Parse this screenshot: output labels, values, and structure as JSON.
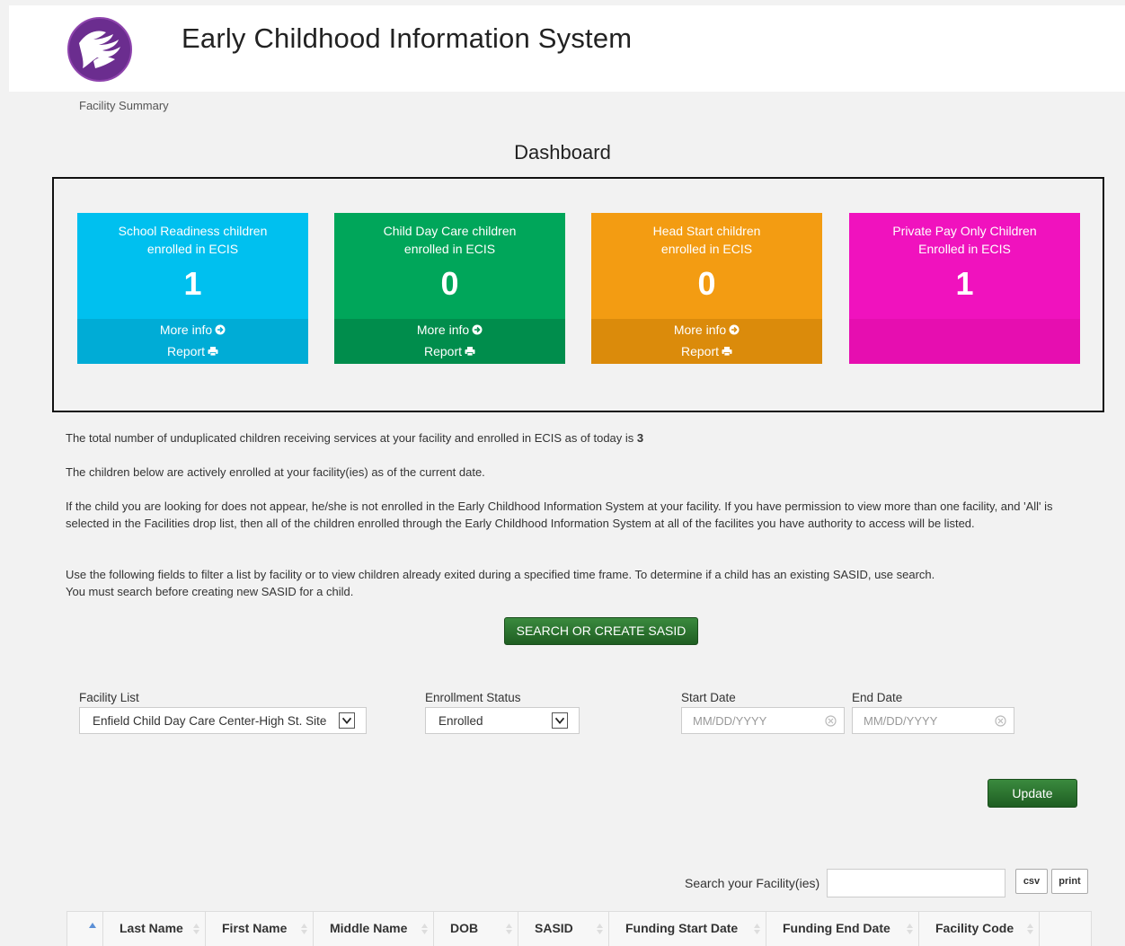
{
  "app": {
    "title": "Early Childhood Information System"
  },
  "breadcrumb": "Facility Summary",
  "dashboard": {
    "title": "Dashboard",
    "tiles": [
      {
        "line1": "School Readiness children",
        "line2": "enrolled in ECIS",
        "count": "1",
        "more_info": "More info",
        "report": "Report",
        "color": "#00c0ef",
        "footer_color": "#00acd6"
      },
      {
        "line1": "Child Day Care children",
        "line2": "enrolled in ECIS",
        "count": "0",
        "more_info": "More info",
        "report": "Report",
        "color": "#00a65a",
        "footer_color": "#008d4c"
      },
      {
        "line1": "Head Start children",
        "line2": "enrolled in ECIS",
        "count": "0",
        "more_info": "More info",
        "report": "Report",
        "color": "#f39c12",
        "footer_color": "#db8b0b"
      },
      {
        "line1": "Private Pay Only Children",
        "line2": "Enrolled in ECIS",
        "count": "1",
        "color": "#f012be",
        "footer_color": "#e60eb0"
      }
    ]
  },
  "info": {
    "total_text": "The total number of unduplicated children receiving services at your facility and enrolled in ECIS as of today is",
    "total_count": "3",
    "active_text": "The children below are actively enrolled at your facility(ies) as of the current date.",
    "not_found_text": "If the child you are looking for does not appear, he/she is not enrolled in the Early Childhood Information System at your facility. If you have permission to view more than one facility, and 'All' is selected in the Facilities drop list, then all of the children enrolled through the Early Childhood Information System at all of the facilites you have authority to access will be listed.",
    "filter_text_1": "Use the following fields to filter a list by facility or to view children already exited during a specified time frame. To determine if a child has an existing SASID, use search.",
    "filter_text_2": "You must search before creating new SASID for a child."
  },
  "search_sasid_button": "SEARCH OR CREATE SASID",
  "filters": {
    "facility_label": "Facility List",
    "facility_value": "Enfield Child Day Care Center-High St. Site",
    "status_label": "Enrollment Status",
    "status_value": "Enrolled",
    "start_label": "Start Date",
    "start_placeholder": "MM/DD/YYYY",
    "end_label": "End Date",
    "end_placeholder": "MM/DD/YYYY"
  },
  "update_button": "Update",
  "table_tools": {
    "search_label": "Search your Facility(ies)",
    "csv": "csv",
    "print": "print"
  },
  "table": {
    "columns": [
      "Last Name",
      "First Name",
      "Middle Name",
      "DOB",
      "SASID",
      "Funding Start Date",
      "Funding End Date",
      "Facility Code"
    ]
  }
}
